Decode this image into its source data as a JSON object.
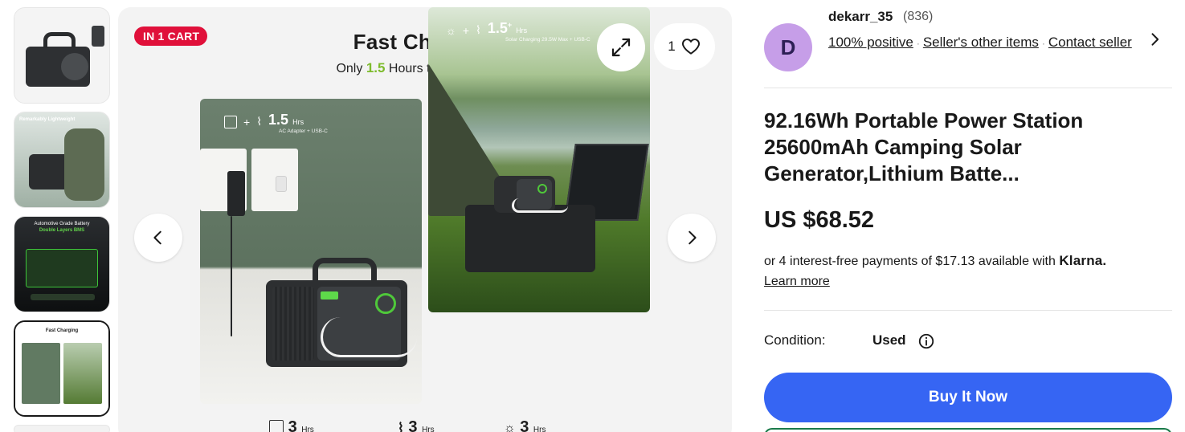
{
  "thumbnails": [
    {
      "label": "",
      "selected": false
    },
    {
      "label": "Remarkably Lightweight",
      "selected": false
    },
    {
      "label": "Automotive Grade Battery",
      "sublabel": "Double Layers BMS",
      "selected": false
    },
    {
      "label": "Fast Charging",
      "selected": true
    }
  ],
  "gallery": {
    "badge": "IN 1 CART",
    "title": "Fast Charging",
    "subtitle_pre": "Only",
    "subtitle_highlight": "1.5",
    "subtitle_post": "Hours to Fully Charge",
    "watch_count": "1",
    "left_panel": {
      "hours": "1.5",
      "unit": "Hrs",
      "caption": "AC Adapter + USB-C"
    },
    "right_panel": {
      "hours": "1.5",
      "unit": "Hrs",
      "caption": "Solar Charging 29.5W Max + USB-C"
    },
    "bottom_specs": [
      {
        "value": "3",
        "unit": "Hrs"
      },
      {
        "value": "3",
        "unit": "Hrs"
      },
      {
        "value": "3",
        "unit": "Hrs"
      }
    ]
  },
  "seller": {
    "avatar_letter": "D",
    "name": "dekarr_35",
    "feedback_count": "(836)",
    "positive": "100% positive",
    "other_items": "Seller's other items",
    "contact": "Contact seller"
  },
  "listing": {
    "title": "92.16Wh Portable Power Station 25600mAh Camping Solar Generator,Lithium Batte...",
    "price": "US $68.52",
    "installments_text": "or 4 interest-free payments of $17.13 available with",
    "klarna": "Klarna.",
    "learn_more": "Learn more",
    "condition_label": "Condition:",
    "condition_value": "Used",
    "buy_now": "Buy It Now"
  },
  "colors": {
    "badge": "#e0103a",
    "buy_button": "#3665f3",
    "avatar": "#c69ee8",
    "highlight": "#7dbb2c"
  }
}
